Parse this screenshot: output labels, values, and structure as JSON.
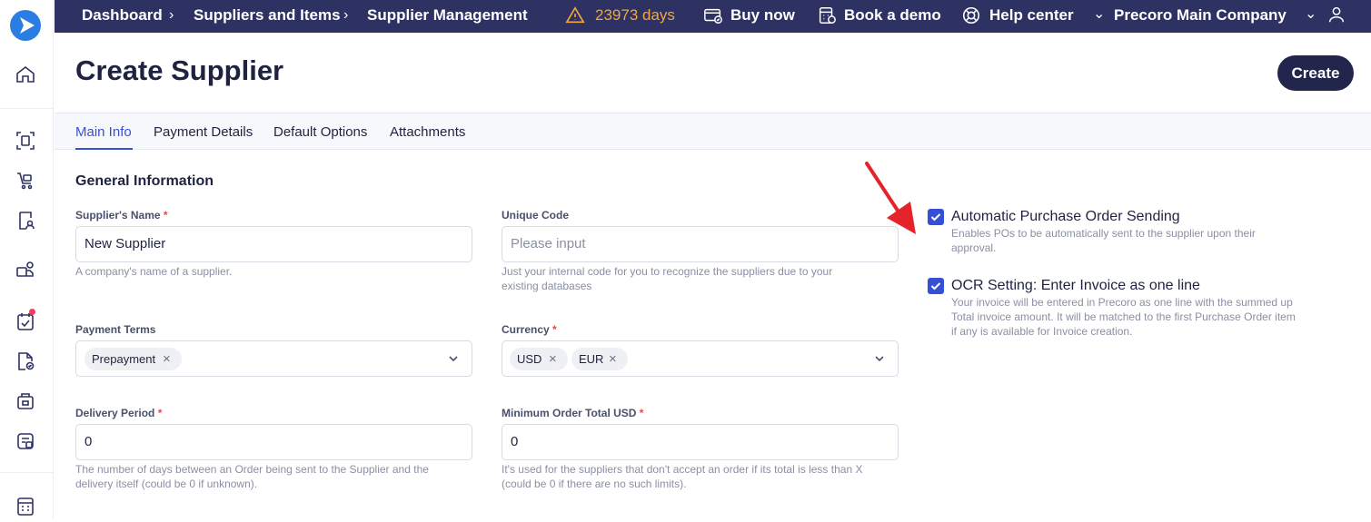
{
  "topbar": {
    "breadcrumb": [
      "Dashboard",
      "Suppliers and Items",
      "Supplier Management"
    ],
    "trial_days": "23973 days",
    "buy_now": "Buy now",
    "book_demo": "Book a demo",
    "help_center": "Help center",
    "company": "Precoro Main Company"
  },
  "page": {
    "title": "Create Supplier",
    "create_label": "Create"
  },
  "tabs": [
    "Main Info",
    "Payment Details",
    "Default Options",
    "Attachments"
  ],
  "form": {
    "section_title": "General Information",
    "supplier_name": {
      "label": "Supplier's Name",
      "required": "*",
      "value": "New Supplier",
      "hint": "A company's name of a supplier."
    },
    "unique_code": {
      "label": "Unique Code",
      "placeholder": "Please input",
      "hint_line1": "Just your internal code for you to recognize the suppliers due to your",
      "hint_line2": "existing databases"
    },
    "payment_terms": {
      "label": "Payment Terms",
      "chips": [
        "Prepayment"
      ]
    },
    "currency": {
      "label": "Currency",
      "required": "*",
      "chips": [
        "USD",
        "EUR"
      ]
    },
    "delivery_period": {
      "label": "Delivery Period",
      "required": "*",
      "value": "0",
      "hint_line1": "The number of days between an Order being sent to the Supplier and the",
      "hint_line2": "delivery itself (could be 0 if unknown)."
    },
    "minimum_order": {
      "label": "Minimum Order Total USD",
      "required": "*",
      "value": "0",
      "hint_line1": "It's used for the suppliers that don't accept an order if its total is less than X",
      "hint_line2": "(could be 0 if there are no such limits)."
    }
  },
  "settings": {
    "auto_po": {
      "title": "Automatic Purchase Order Sending",
      "checked": true,
      "hint_line1": "Enables POs to be automatically sent to the supplier upon their",
      "hint_line2": "approval."
    },
    "ocr": {
      "title": "OCR Setting: Enter Invoice as one line",
      "checked": true,
      "hint_line1": "Your invoice will be entered in Precoro as one line with the summed up",
      "hint_line2": "Total invoice amount. It will be matched to the first Purchase Order item",
      "hint_line3": "if any is available for Invoice creation."
    }
  },
  "colors": {
    "topbar": "#2e3263",
    "accent": "#3550d6",
    "create_button": "#22264d",
    "warning": "#f3a63b",
    "annotation_arrow": "#e5232b"
  }
}
